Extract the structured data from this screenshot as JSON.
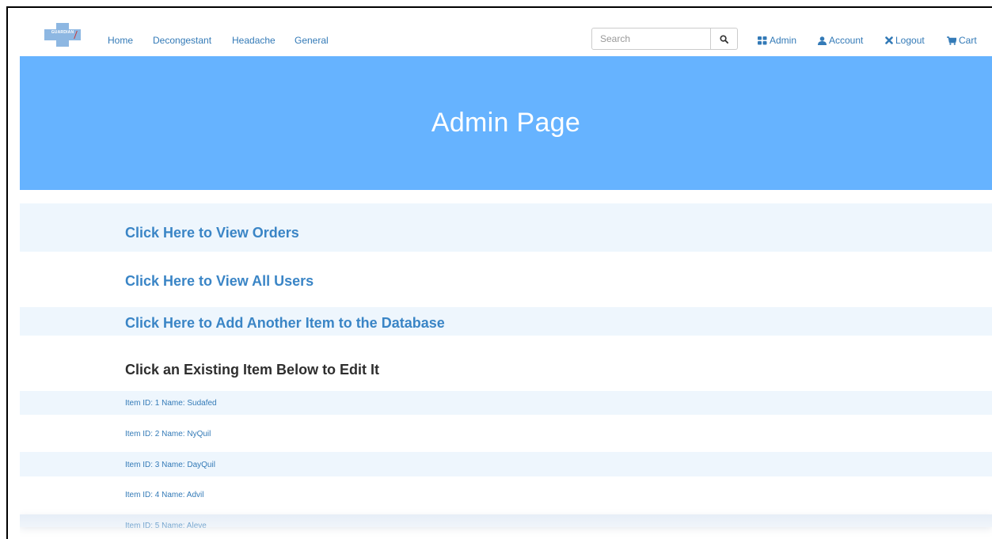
{
  "brand": {
    "logo_text": "GUARDIAN",
    "logo_icon": "medical-cross-logo"
  },
  "nav": {
    "links": [
      "Home",
      "Decongestant",
      "Headache",
      "General"
    ],
    "search_placeholder": "Search",
    "admin_label": "Admin",
    "account_label": "Account",
    "logout_label": "Logout",
    "cart_label": "Cart"
  },
  "jumbotron": {
    "title": "Admin Page"
  },
  "admin_links": {
    "view_orders": "Click Here to View Orders",
    "view_users": "Click Here to View All Users",
    "add_item": "Click Here to Add Another Item to the Database"
  },
  "edit_section": {
    "title": "Click an Existing Item Below to Edit It",
    "items": [
      "Item ID: 1 Name: Sudafed",
      "Item ID: 2 Name: NyQuil",
      "Item ID: 3 Name: DayQuil",
      "Item ID: 4 Name: Advil",
      "Item ID: 5 Name: Aleve"
    ]
  },
  "colors": {
    "accent": "#337ab7",
    "jumbotron": "#66b3ff",
    "row_alt": "#eef6fd"
  }
}
